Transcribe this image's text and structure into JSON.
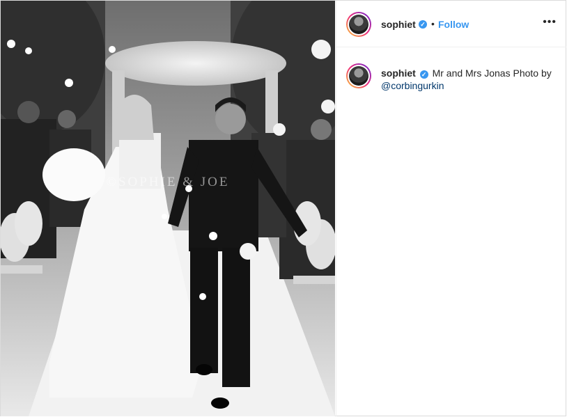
{
  "post": {
    "username": "sophiet",
    "verified_icon": "verified-badge-icon",
    "separator": "•",
    "follow_label": "Follow",
    "more_label": "•••",
    "watermark": "©SOPHIE & JOE"
  },
  "caption": {
    "username": "sophiet",
    "text": "Mr and Mrs Jonas Photo by",
    "mention": "@corbingurkin"
  },
  "colors": {
    "accent": "#3897f0",
    "text": "#262626",
    "border": "#dbdbdb"
  }
}
